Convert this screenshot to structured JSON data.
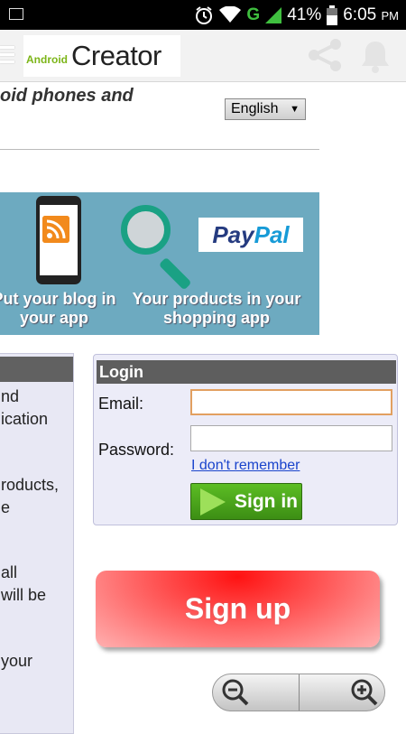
{
  "status_bar": {
    "network": "G",
    "battery": "41%",
    "time": "6:05",
    "ampm": "PM"
  },
  "app_bar": {
    "logo_small": "Android",
    "logo_big": "Creator"
  },
  "page": {
    "tagline": "oid phones and",
    "language": "English",
    "banner": {
      "caption_left": "Put your blog in your app",
      "caption_right": "Your products in your shopping app",
      "paypal_pay": "Pay",
      "paypal_pal": "Pal"
    },
    "left_panel_lines": [
      "nd",
      "ication",
      "roducts,",
      "e",
      "all",
      "will be",
      "your"
    ],
    "login": {
      "title": "Login",
      "email_label": "Email:",
      "password_label": "Password:",
      "forgot_link": "I don't remember",
      "signin_label": "Sign in"
    },
    "signup_label": "Sign up"
  },
  "colors": {
    "banner_bg": "#6daac0",
    "signin_green": "#4aa61c",
    "signup_red": "#ff2a2a",
    "panel_header": "#5e5e5e"
  }
}
